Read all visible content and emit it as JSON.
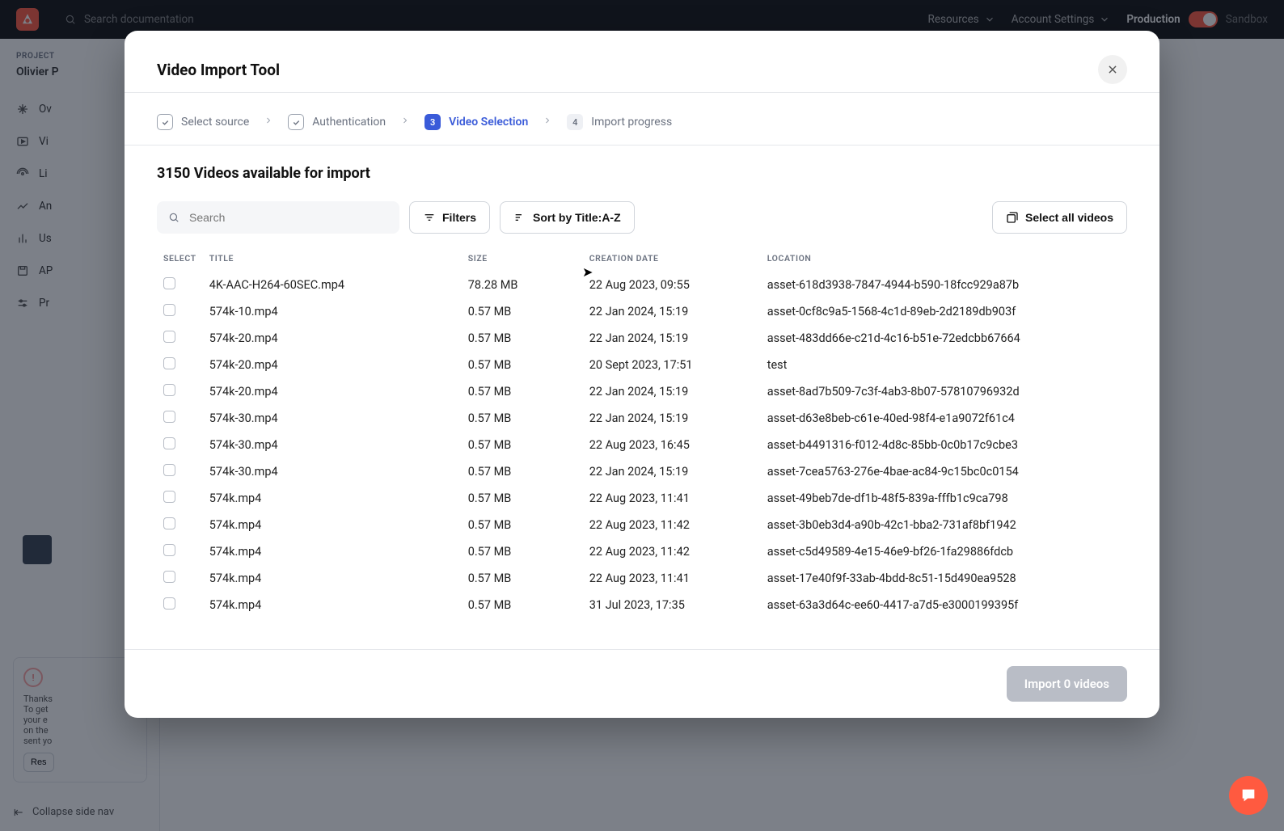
{
  "topnav": {
    "search_placeholder": "Search documentation",
    "links": {
      "resources": "Resources",
      "account": "Account Settings"
    },
    "env": {
      "prod": "Production",
      "sandbox": "Sandbox"
    }
  },
  "sidebar": {
    "section_label": "PROJECT",
    "project_name": "Olivier P",
    "items": [
      "Ov",
      "Vi",
      "Li",
      "An",
      "Us",
      "AP",
      "Pr"
    ],
    "card": {
      "l1": "Thanks",
      "l2": "To get",
      "l3": "your e",
      "l4": "on the",
      "l5": "sent yo",
      "button": "Res"
    },
    "collapse": "Collapse side nav"
  },
  "modal": {
    "title": "Video Import Tool",
    "steps": [
      {
        "label": "Select source",
        "state": "done"
      },
      {
        "label": "Authentication",
        "state": "done"
      },
      {
        "label": "Video Selection",
        "state": "active",
        "num": "3"
      },
      {
        "label": "Import progress",
        "state": "upcoming",
        "num": "4"
      }
    ],
    "count_line": "3150 Videos available for import",
    "search_placeholder": "Search",
    "filters_label": "Filters",
    "sort_label": "Sort by Title:A-Z",
    "select_all_label": "Select all videos",
    "columns": {
      "select": "SELECT",
      "title": "TITLE",
      "size": "SIZE",
      "date": "CREATION DATE",
      "location": "LOCATION"
    },
    "rows": [
      {
        "title": "4K-AAC-H264-60SEC.mp4",
        "size": "78.28 MB",
        "date": "22 Aug 2023, 09:55",
        "location": "asset-618d3938-7847-4944-b590-18fcc929a87b"
      },
      {
        "title": "574k-10.mp4",
        "size": "0.57 MB",
        "date": "22 Jan 2024, 15:19",
        "location": "asset-0cf8c9a5-1568-4c1d-89eb-2d2189db903f"
      },
      {
        "title": "574k-20.mp4",
        "size": "0.57 MB",
        "date": "22 Jan 2024, 15:19",
        "location": "asset-483dd66e-c21d-4c16-b51e-72edcbb67664"
      },
      {
        "title": "574k-20.mp4",
        "size": "0.57 MB",
        "date": "20 Sept 2023, 17:51",
        "location": "test"
      },
      {
        "title": "574k-20.mp4",
        "size": "0.57 MB",
        "date": "22 Jan 2024, 15:19",
        "location": "asset-8ad7b509-7c3f-4ab3-8b07-57810796932d"
      },
      {
        "title": "574k-30.mp4",
        "size": "0.57 MB",
        "date": "22 Jan 2024, 15:19",
        "location": "asset-d63e8beb-c61e-40ed-98f4-e1a9072f61c4"
      },
      {
        "title": "574k-30.mp4",
        "size": "0.57 MB",
        "date": "22 Aug 2023, 16:45",
        "location": "asset-b4491316-f012-4d8c-85bb-0c0b17c9cbe3"
      },
      {
        "title": "574k-30.mp4",
        "size": "0.57 MB",
        "date": "22 Jan 2024, 15:19",
        "location": "asset-7cea5763-276e-4bae-ac84-9c15bc0c0154"
      },
      {
        "title": "574k.mp4",
        "size": "0.57 MB",
        "date": "22 Aug 2023, 11:41",
        "location": "asset-49beb7de-df1b-48f5-839a-fffb1c9ca798"
      },
      {
        "title": "574k.mp4",
        "size": "0.57 MB",
        "date": "22 Aug 2023, 11:42",
        "location": "asset-3b0eb3d4-a90b-42c1-bba2-731af8bf1942"
      },
      {
        "title": "574k.mp4",
        "size": "0.57 MB",
        "date": "22 Aug 2023, 11:42",
        "location": "asset-c5d49589-4e15-46e9-bf26-1fa29886fdcb"
      },
      {
        "title": "574k.mp4",
        "size": "0.57 MB",
        "date": "22 Aug 2023, 11:41",
        "location": "asset-17e40f9f-33ab-4bdd-8c51-15d490ea9528"
      },
      {
        "title": "574k.mp4",
        "size": "0.57 MB",
        "date": "31 Jul 2023, 17:35",
        "location": "asset-63a3d64c-ee60-4417-a7d5-e3000199395f"
      }
    ],
    "import_button": "Import 0 videos"
  }
}
